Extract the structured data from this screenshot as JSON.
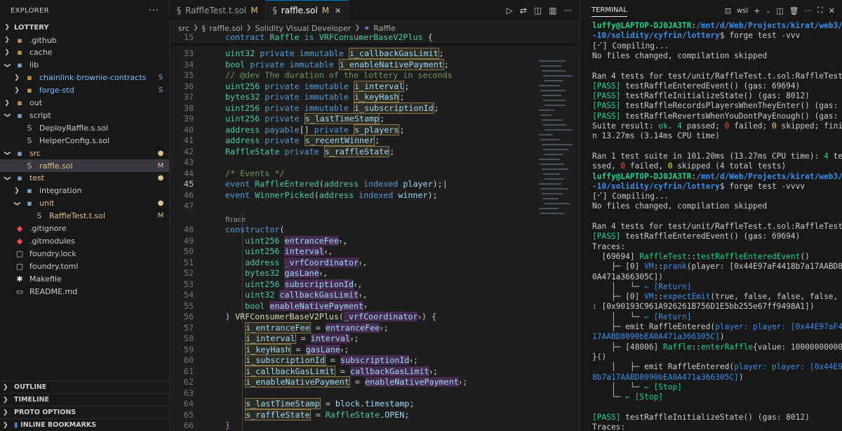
{
  "explorer": {
    "title": "EXPLORER",
    "more": "···",
    "root": "LOTTERY",
    "items": [
      {
        "label": ".github",
        "kind": "folder",
        "icon": "▪",
        "depth": 0,
        "open": false,
        "color": "#cccccc",
        "badge": ""
      },
      {
        "label": "cache",
        "kind": "folder",
        "icon": "▪",
        "depth": 0,
        "open": false,
        "color": "#cccccc",
        "badge": ""
      },
      {
        "label": "lib",
        "kind": "folder",
        "icon": "▪",
        "depth": 0,
        "open": true,
        "color": "#cccccc",
        "badge": ""
      },
      {
        "label": "chainlink-brownie-contracts",
        "kind": "folder",
        "icon": "▪",
        "depth": 1,
        "open": false,
        "color": "#75beff",
        "badge": "S"
      },
      {
        "label": "forge-std",
        "kind": "folder",
        "icon": "▪",
        "depth": 1,
        "open": false,
        "color": "#75beff",
        "badge": "S"
      },
      {
        "label": "out",
        "kind": "folder",
        "icon": "▪",
        "depth": 0,
        "open": false,
        "color": "#cccccc",
        "badge": ""
      },
      {
        "label": "script",
        "kind": "folder",
        "icon": "▪",
        "depth": 0,
        "open": true,
        "color": "#cccccc",
        "badge": ""
      },
      {
        "label": "DeployRaffle.s.sol",
        "kind": "file",
        "icon": "S",
        "depth": 1,
        "open": false,
        "color": "#cccccc",
        "badge": ""
      },
      {
        "label": "HelperConfig.s.sol",
        "kind": "file",
        "icon": "S",
        "depth": 1,
        "open": false,
        "color": "#cccccc",
        "badge": ""
      },
      {
        "label": "src",
        "kind": "folder",
        "icon": "▪",
        "depth": 0,
        "open": true,
        "color": "#e2c08d",
        "badge": "●"
      },
      {
        "label": "raffle.sol",
        "kind": "file",
        "icon": "S",
        "depth": 1,
        "open": false,
        "color": "#e2c08d",
        "badge": "M",
        "selected": true
      },
      {
        "label": "test",
        "kind": "folder",
        "icon": "▪",
        "depth": 0,
        "open": true,
        "color": "#e2c08d",
        "badge": "●"
      },
      {
        "label": "integration",
        "kind": "folder",
        "icon": "▪",
        "depth": 1,
        "open": false,
        "color": "#cccccc",
        "badge": ""
      },
      {
        "label": "unit",
        "kind": "folder",
        "icon": "▪",
        "depth": 1,
        "open": true,
        "color": "#e2c08d",
        "badge": "●"
      },
      {
        "label": "RaffleTest.t.sol",
        "kind": "file",
        "icon": "S",
        "depth": 2,
        "open": false,
        "color": "#e2c08d",
        "badge": "M"
      },
      {
        "label": ".gitignore",
        "kind": "file",
        "icon": "◆",
        "depth": 0,
        "open": false,
        "color": "#cccccc",
        "badge": ""
      },
      {
        "label": ".gitmodules",
        "kind": "file",
        "icon": "◆",
        "depth": 0,
        "open": false,
        "color": "#cccccc",
        "badge": ""
      },
      {
        "label": "foundry.lock",
        "kind": "file",
        "icon": "▢",
        "depth": 0,
        "open": false,
        "color": "#cccccc",
        "badge": ""
      },
      {
        "label": "foundry.toml",
        "kind": "file",
        "icon": "▢",
        "depth": 0,
        "open": false,
        "color": "#cccccc",
        "badge": ""
      },
      {
        "label": "Makefile",
        "kind": "file",
        "icon": "✱",
        "depth": 0,
        "open": false,
        "color": "#cccccc",
        "badge": ""
      },
      {
        "label": "README.md",
        "kind": "file",
        "icon": "▭",
        "depth": 0,
        "open": false,
        "color": "#cccccc",
        "badge": ""
      }
    ],
    "sections": [
      "OUTLINE",
      "TIMELINE",
      "PROTO OPTIONS",
      "INLINE BOOKMARKS"
    ]
  },
  "editor": {
    "tabs": [
      {
        "label": "RaffleTest.t.sol",
        "modified": "M",
        "active": false
      },
      {
        "label": "raffle.sol",
        "modified": "M",
        "active": true
      }
    ],
    "breadcrumb": [
      "src",
      "raffle.sol",
      "Solidity Visual Developer",
      "Raffle"
    ],
    "sticky_line": {
      "num": "15",
      "text": "contract Raffle is VRFConsumerBaseV2Plus {"
    },
    "codelens": "ftrace",
    "current_line": "45"
  },
  "terminal": {
    "title": "TERMINAL",
    "shell": "wsl"
  },
  "colors": {
    "accent": "#0078d4",
    "modified": "#e2c08d",
    "pass": "#23d18b"
  }
}
